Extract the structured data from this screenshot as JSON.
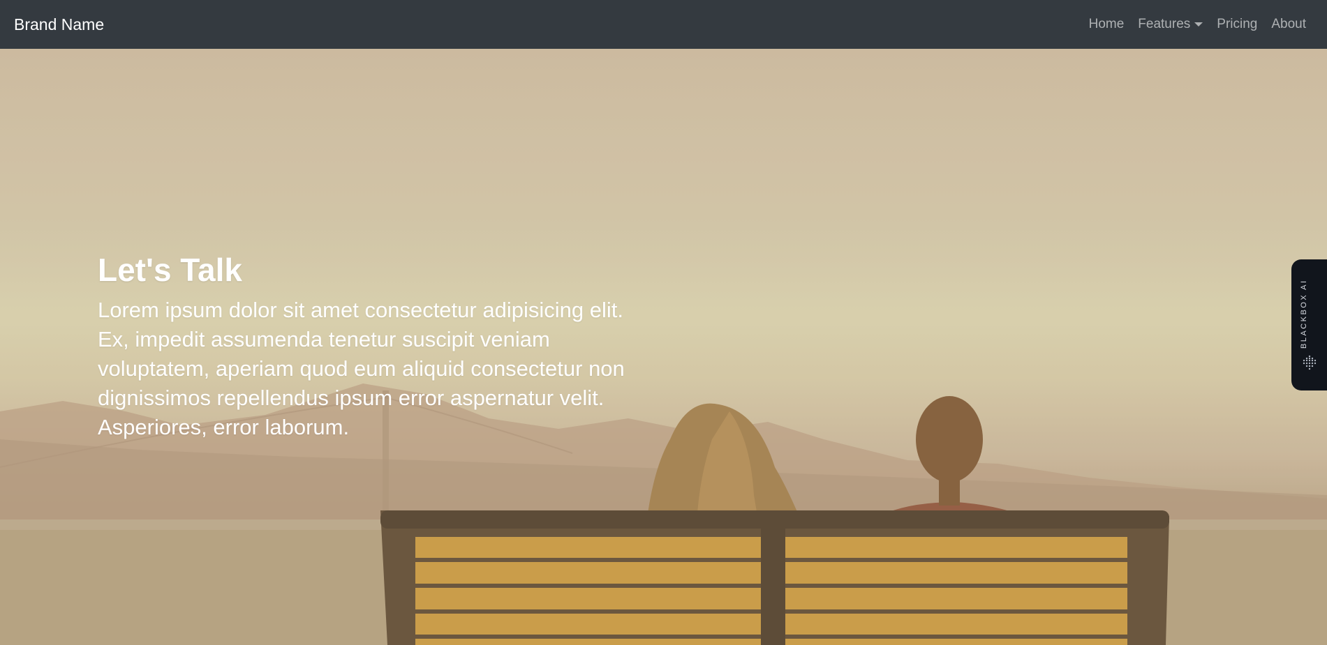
{
  "navbar": {
    "brand": "Brand Name",
    "links": [
      {
        "label": "Home"
      },
      {
        "label": "Features"
      },
      {
        "label": "Pricing"
      },
      {
        "label": "About"
      }
    ]
  },
  "hero": {
    "title": "Let's Talk",
    "body": "Lorem ipsum dolor sit amet consectetur adipisicing elit. Ex, impedit assumenda tenetur suscipit veniam voluptatem, aperiam quod eum aliquid consectetur non dignissimos repellendus ipsum error aspernatur velit. Asperiores, error laborum."
  },
  "side_widget": {
    "label": "BLACKBOX AI",
    "icon": "blackbox-dots-icon"
  },
  "colors": {
    "navbar_bg": "#343a40",
    "widget_bg": "#11151c"
  }
}
